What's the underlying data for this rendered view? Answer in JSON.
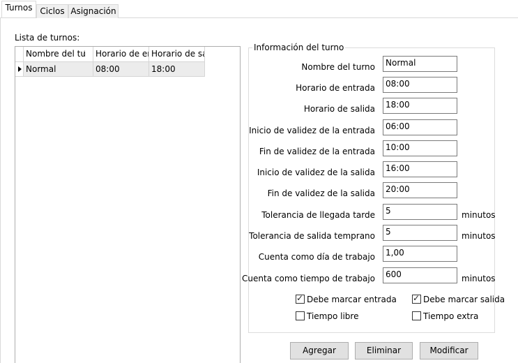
{
  "tabs": [
    {
      "label": "Turnos",
      "active": true
    },
    {
      "label": "Ciclos",
      "active": false
    },
    {
      "label": "Asignación",
      "active": false
    }
  ],
  "shift_list": {
    "label": "Lista de turnos:",
    "columns": [
      "Nombre del tu",
      "Horario de ent",
      "Horario de sal"
    ],
    "rows": [
      {
        "cells": [
          "Normal",
          "08:00",
          "18:00"
        ],
        "selected": true
      }
    ]
  },
  "shift_info": {
    "title": "Información del turno",
    "fields": [
      {
        "label": "Nombre del turno",
        "value": "Normal",
        "unit": ""
      },
      {
        "label": "Horario de entrada",
        "value": "08:00",
        "unit": ""
      },
      {
        "label": "Horario de salida",
        "value": "18:00",
        "unit": ""
      },
      {
        "label": "Inicio de validez de la entrada",
        "value": "06:00",
        "unit": ""
      },
      {
        "label": "Fin de validez de la entrada",
        "value": "10:00",
        "unit": ""
      },
      {
        "label": "Inicio de validez de la salida",
        "value": "16:00",
        "unit": ""
      },
      {
        "label": "Fin de validez de la salida",
        "value": "20:00",
        "unit": ""
      },
      {
        "label": "Tolerancia de llegada tarde",
        "value": "5",
        "unit": "minutos"
      },
      {
        "label": "Tolerancia de salida temprano",
        "value": "5",
        "unit": "minutos"
      },
      {
        "label": "Cuenta como día de trabajo",
        "value": "1,00",
        "unit": ""
      },
      {
        "label": "Cuenta como tiempo de trabajo",
        "value": "600",
        "unit": "minutos"
      }
    ],
    "checkboxes": [
      {
        "label": "Debe marcar entrada",
        "checked": true
      },
      {
        "label": "Debe marcar salida",
        "checked": true
      },
      {
        "label": "Tiempo libre",
        "checked": false
      },
      {
        "label": "Tiempo extra",
        "checked": false
      }
    ]
  },
  "buttons": {
    "add": "Agregar",
    "delete": "Eliminar",
    "modify": "Modificar"
  },
  "icons": {
    "row_indicator": "row-pointer-icon",
    "sort": "sort-ascending-icon",
    "check": "checkmark-icon"
  }
}
